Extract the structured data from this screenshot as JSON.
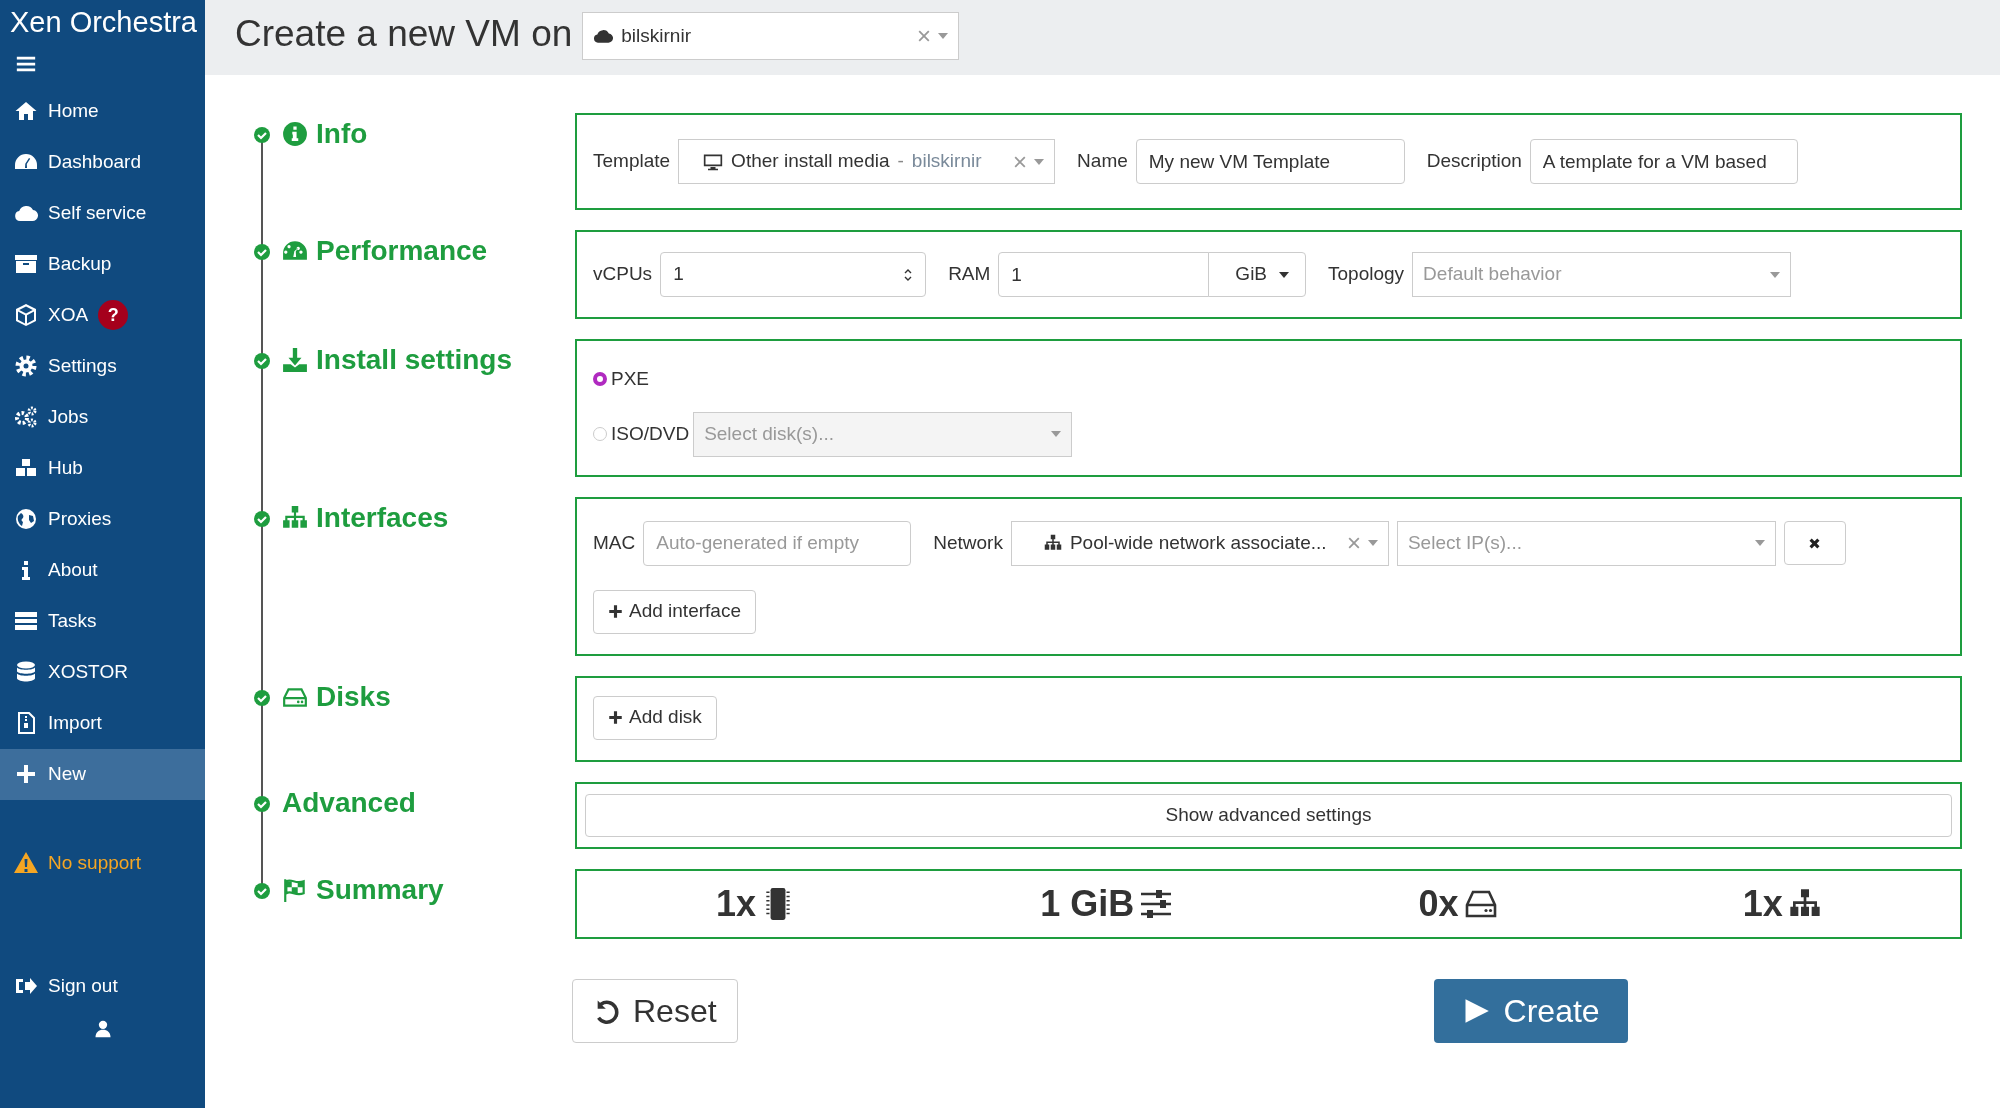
{
  "sidebar": {
    "title": "Xen Orchestra",
    "nav": [
      {
        "label": "Home",
        "selected": false
      },
      {
        "label": "Dashboard",
        "selected": false
      },
      {
        "label": "Self service",
        "selected": false
      },
      {
        "label": "Backup",
        "selected": false
      },
      {
        "label": "XOA",
        "selected": false,
        "badge": "?"
      },
      {
        "label": "Settings",
        "selected": false
      },
      {
        "label": "Jobs",
        "selected": false
      },
      {
        "label": "Hub",
        "selected": false
      },
      {
        "label": "Proxies",
        "selected": false
      },
      {
        "label": "About",
        "selected": false
      },
      {
        "label": "Tasks",
        "selected": false
      },
      {
        "label": "XOSTOR",
        "selected": false
      },
      {
        "label": "Import",
        "selected": false
      },
      {
        "label": "New",
        "selected": true
      }
    ],
    "support_warning": "No support",
    "sign_out": "Sign out"
  },
  "header": {
    "title": "Create a new VM on",
    "pool": "bilskirnir"
  },
  "sections": [
    {
      "title": "Info",
      "complete": true
    },
    {
      "title": "Performance",
      "complete": true
    },
    {
      "title": "Install settings",
      "complete": true
    },
    {
      "title": "Interfaces",
      "complete": true
    },
    {
      "title": "Disks",
      "complete": true
    },
    {
      "title": "Advanced",
      "complete": true
    },
    {
      "title": "Summary",
      "complete": true
    }
  ],
  "info": {
    "template_label": "Template",
    "template_name": "Other install media",
    "template_separator": "-",
    "template_pool": "bilskirnir",
    "name_label": "Name",
    "name_value": "My new VM Template",
    "description_label": "Description",
    "description_value": "A template for a VM based"
  },
  "performance": {
    "vcpus_label": "vCPUs",
    "vcpus_value": "1",
    "ram_label": "RAM",
    "ram_value": "1",
    "ram_unit": "GiB",
    "topology_label": "Topology",
    "topology_placeholder": "Default behavior"
  },
  "install": {
    "options": [
      {
        "label": "PXE",
        "selected": true
      },
      {
        "label": "ISO/DVD",
        "selected": false,
        "placeholder": "Select disk(s)..."
      }
    ]
  },
  "interfaces": {
    "mac_label": "MAC",
    "mac_placeholder": "Auto-generated if empty",
    "network_label": "Network",
    "network_value": "Pool-wide network associate...",
    "ip_placeholder": "Select IP(s)...",
    "add_button": "Add interface"
  },
  "disks": {
    "add_button": "Add disk"
  },
  "advanced": {
    "button": "Show advanced settings"
  },
  "summary": [
    {
      "kind": "cpu",
      "value": "1x"
    },
    {
      "kind": "ram",
      "value": "1 GiB"
    },
    {
      "kind": "disk",
      "value": "0x"
    },
    {
      "kind": "network",
      "value": "1x"
    }
  ],
  "actions": {
    "reset": "Reset",
    "create": "Create"
  }
}
